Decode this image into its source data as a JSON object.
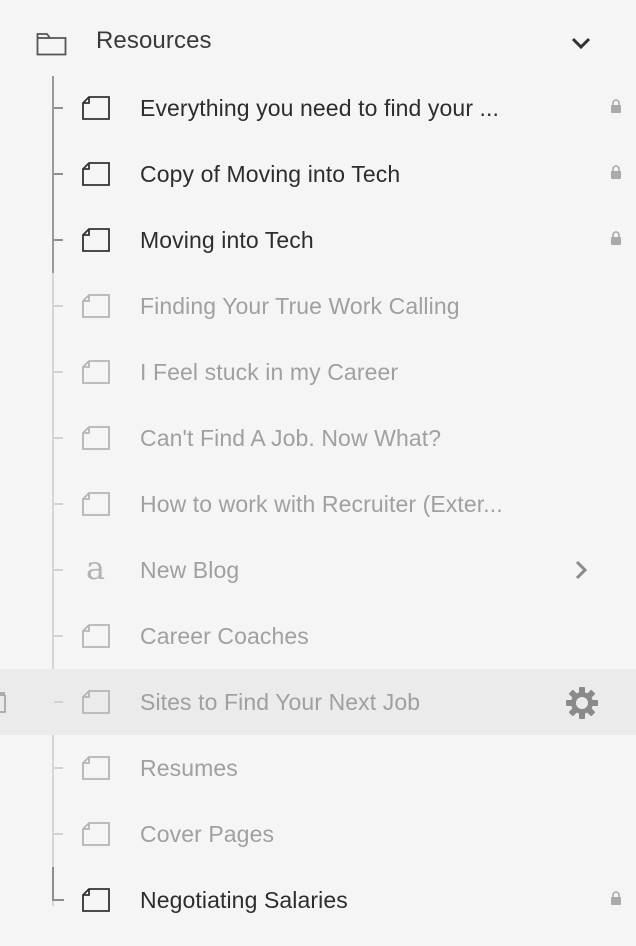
{
  "folder": {
    "label": "Resources",
    "icon": "folder-icon",
    "expanded": true
  },
  "items": [
    {
      "label": "Everything you need to find your ...",
      "icon": "page-icon",
      "enabled": true,
      "locked": true
    },
    {
      "label": "Copy of Moving into Tech",
      "icon": "page-icon",
      "enabled": true,
      "locked": true
    },
    {
      "label": "Moving into Tech",
      "icon": "page-icon",
      "enabled": true,
      "locked": true
    },
    {
      "label": "Finding Your True Work Calling",
      "icon": "page-icon",
      "enabled": false,
      "locked": false
    },
    {
      "label": "I Feel stuck in my Career",
      "icon": "page-icon",
      "enabled": false,
      "locked": false
    },
    {
      "label": "Can't Find A Job. Now What?",
      "icon": "page-icon",
      "enabled": false,
      "locked": false
    },
    {
      "label": "How to work with Recruiter (Exter...",
      "icon": "page-icon",
      "enabled": false,
      "locked": false
    },
    {
      "label": "New Blog",
      "icon": "blog-icon",
      "enabled": false,
      "locked": false,
      "has_children": true
    },
    {
      "label": "Career Coaches",
      "icon": "page-icon",
      "enabled": false,
      "locked": false
    },
    {
      "label": "Sites to Find Your Next Job",
      "icon": "page-icon",
      "enabled": false,
      "locked": false,
      "selected": true
    },
    {
      "label": "Resumes",
      "icon": "page-icon",
      "enabled": false,
      "locked": false
    },
    {
      "label": "Cover Pages",
      "icon": "page-icon",
      "enabled": false,
      "locked": false
    },
    {
      "label": "Negotiating Salaries",
      "icon": "page-icon",
      "enabled": true,
      "locked": true
    }
  ],
  "colors": {
    "background": "#f5f5f5",
    "selected_row": "#ebebeb",
    "enabled_text": "#2d2d2d",
    "disabled_text": "#a0a0a0"
  }
}
